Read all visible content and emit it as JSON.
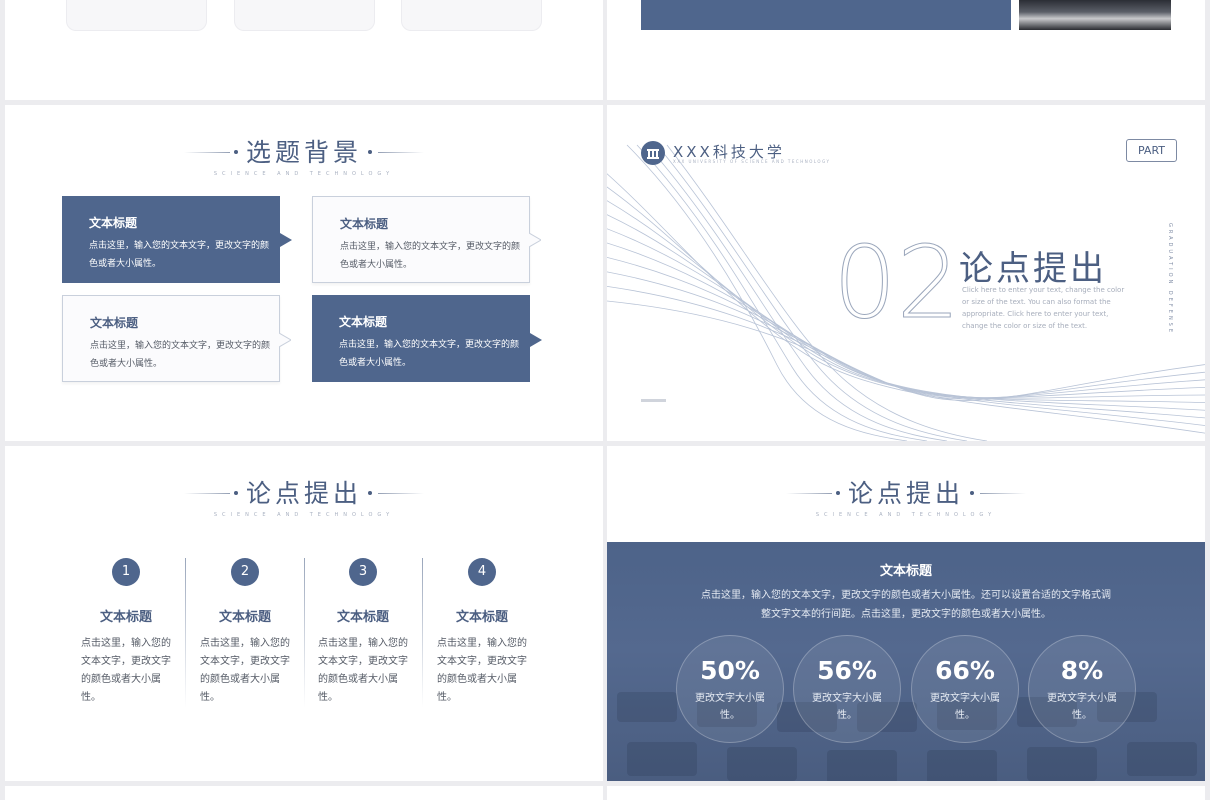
{
  "colors": {
    "primary": "#4f668d",
    "text_dark": "#4c5f82",
    "text_body": "#555b66"
  },
  "slide_background": {
    "section_title": "选题背景",
    "section_sub": "SCIENCE AND TECHNOLOGY",
    "boxes": [
      {
        "title": "文本标题",
        "body": "点击这里，输入您的文本文字，更改文字的颜色或者大小属性。"
      },
      {
        "title": "文本标题",
        "body": "点击这里，输入您的文本文字，更改文字的颜色或者大小属性。"
      },
      {
        "title": "文本标题",
        "body": "点击这里，输入您的文本文字，更改文字的颜色或者大小属性。"
      },
      {
        "title": "文本标题",
        "body": "点击这里，输入您的文本文字，更改文字的颜色或者大小属性。"
      }
    ]
  },
  "slide_part": {
    "logo_icon": "university-building-icon",
    "school": "XXX科技大学",
    "school_sub": "XXX UNIVERSITY OF SCIENCE AND TECHNOLOGY",
    "part_label": "PART",
    "number": "02",
    "title": "论点提出",
    "desc": "Click here to enter your text, change the color or size of the text. You can also format the appropriate. Click here to enter your text, change the color or size of the text.",
    "side_text": "GRADUATION DEFENSE"
  },
  "slide_points": {
    "section_title": "论点提出",
    "section_sub": "SCIENCE AND TECHNOLOGY",
    "columns": [
      {
        "num": "1",
        "title": "文本标题",
        "body": "点击这里，输入您的文本文字，更改文字的颜色或者大小属性。"
      },
      {
        "num": "2",
        "title": "文本标题",
        "body": "点击这里，输入您的文本文字，更改文字的颜色或者大小属性。"
      },
      {
        "num": "3",
        "title": "文本标题",
        "body": "点击这里，输入您的文本文字，更改文字的颜色或者大小属性。"
      },
      {
        "num": "4",
        "title": "文本标题",
        "body": "点击这里，输入您的文本文字，更改文字的颜色或者大小属性。"
      }
    ]
  },
  "slide_stats": {
    "section_title": "论点提出",
    "section_sub": "SCIENCE AND TECHNOLOGY",
    "panel_title": "文本标题",
    "panel_desc": "点击这里，输入您的文本文字，更改文字的颜色或者大小属性。还可以设置合适的文字格式调整文字文本的行间距。点击这里，更改文字的颜色或者大小属性。",
    "stats": [
      {
        "pct": "50%",
        "label": "更改文字大小属性。"
      },
      {
        "pct": "56%",
        "label": "更改文字大小属性。"
      },
      {
        "pct": "66%",
        "label": "更改文字大小属性。"
      },
      {
        "pct": "8%",
        "label": "更改文字大小属性。"
      }
    ]
  }
}
